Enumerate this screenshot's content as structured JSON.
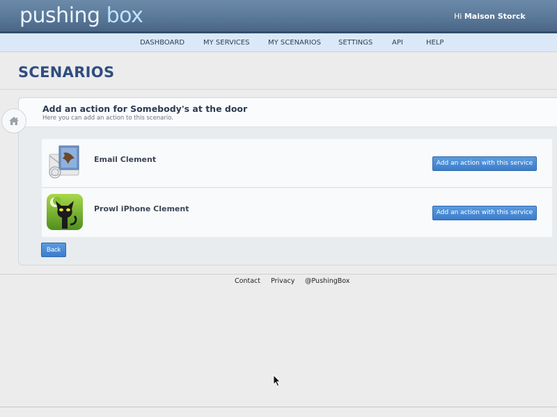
{
  "header": {
    "logo_part1": "pushing",
    "logo_part2": "box",
    "greeting_prefix": "Hi",
    "user_name": "Maison Storck"
  },
  "nav": {
    "items": [
      {
        "label": "DASHBOARD"
      },
      {
        "label": "MY SERVICES"
      },
      {
        "label": "MY SCENARIOS"
      },
      {
        "label": "SETTINGS"
      },
      {
        "label": "API"
      },
      {
        "label": "HELP"
      }
    ]
  },
  "page": {
    "title": "SCENARIOS"
  },
  "panel": {
    "title": "Add an action for Somebody's at the door",
    "subtitle": "Here you can add an action to this scenario.",
    "home_icon": "home-icon",
    "services": [
      {
        "name": "Email Clement",
        "icon": "mail-icon",
        "button_label": "Add an action with this service"
      },
      {
        "name": "Prowl iPhone Clement",
        "icon": "prowl-cat-icon",
        "button_label": "Add an action with this service"
      }
    ],
    "back_label": "Back"
  },
  "footer": {
    "links": [
      {
        "label": "Contact"
      },
      {
        "label": "Privacy"
      },
      {
        "label": "@PushingBox"
      }
    ]
  },
  "colors": {
    "header": "#5a7898",
    "nav": "#dbe8f7",
    "title": "#2f4d80",
    "button": "#3c7dcc"
  }
}
